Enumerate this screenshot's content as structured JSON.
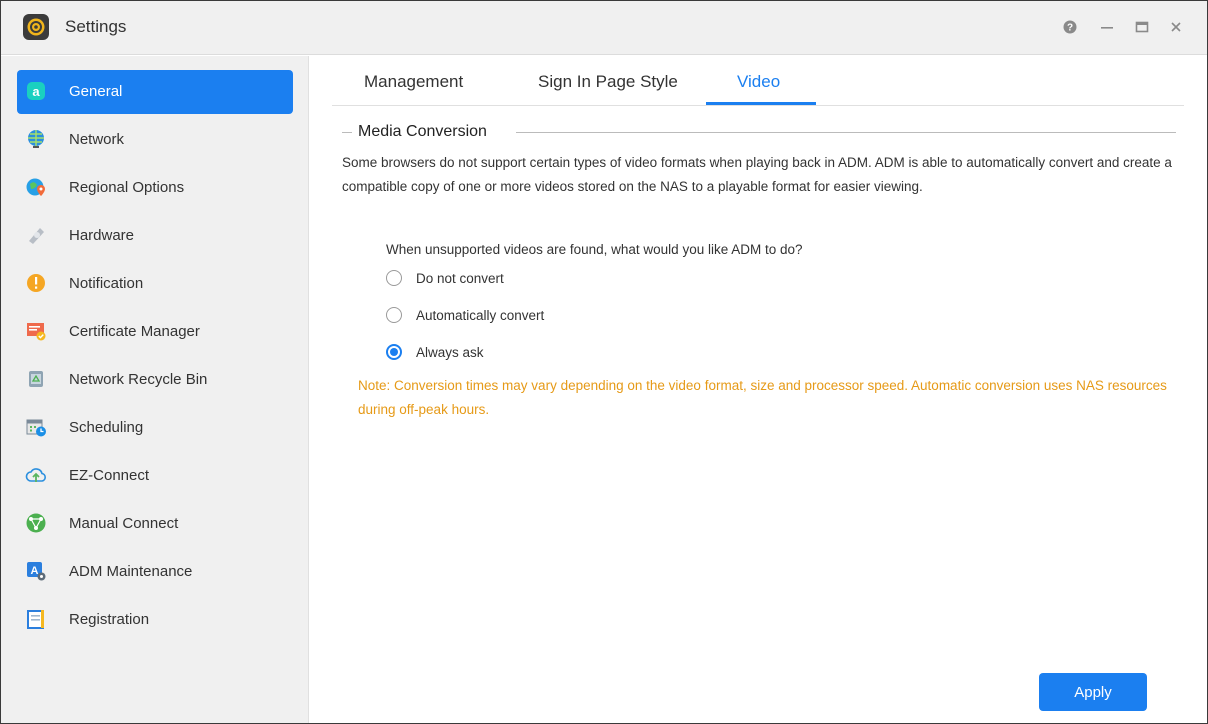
{
  "window": {
    "title": "Settings",
    "controls": {
      "help": "help-icon",
      "minimize": "minimize-icon",
      "maximize": "maximize-icon",
      "close": "close-icon"
    }
  },
  "sidebar": {
    "items": [
      {
        "label": "General",
        "icon": "general-icon",
        "active": true
      },
      {
        "label": "Network",
        "icon": "globe-icon"
      },
      {
        "label": "Regional Options",
        "icon": "location-icon"
      },
      {
        "label": "Hardware",
        "icon": "hardware-icon"
      },
      {
        "label": "Notification",
        "icon": "alert-icon"
      },
      {
        "label": "Certificate Manager",
        "icon": "certificate-icon"
      },
      {
        "label": "Network Recycle Bin",
        "icon": "recycle-bin-icon"
      },
      {
        "label": "Scheduling",
        "icon": "calendar-icon"
      },
      {
        "label": "EZ-Connect",
        "icon": "cloud-upload-icon"
      },
      {
        "label": "Manual Connect",
        "icon": "network-icon"
      },
      {
        "label": "ADM Maintenance",
        "icon": "maintenance-icon"
      },
      {
        "label": "Registration",
        "icon": "registration-icon"
      }
    ]
  },
  "tabs": [
    {
      "label": "Management"
    },
    {
      "label": "Sign In Page Style"
    },
    {
      "label": "Video",
      "active": true
    }
  ],
  "section": {
    "title": "Media Conversion",
    "description": "Some browsers do not support certain types of video formats when playing back in ADM. ADM is able to automatically convert and create a compatible copy of one or more videos stored on the NAS to a playable format for easier viewing.",
    "question": "When unsupported videos are found, what would you like ADM to do?",
    "options": [
      {
        "label": "Do not convert",
        "checked": false
      },
      {
        "label": "Automatically convert",
        "checked": false
      },
      {
        "label": "Always ask",
        "checked": true
      }
    ],
    "note": "Note: Conversion times may vary depending on the video format, size and processor speed. Automatic conversion uses NAS resources during off-peak hours."
  },
  "footer": {
    "apply_label": "Apply"
  },
  "colors": {
    "accent": "#1b7ff0",
    "note": "#e69a17",
    "sidebar_bg": "#f0f0f0"
  }
}
